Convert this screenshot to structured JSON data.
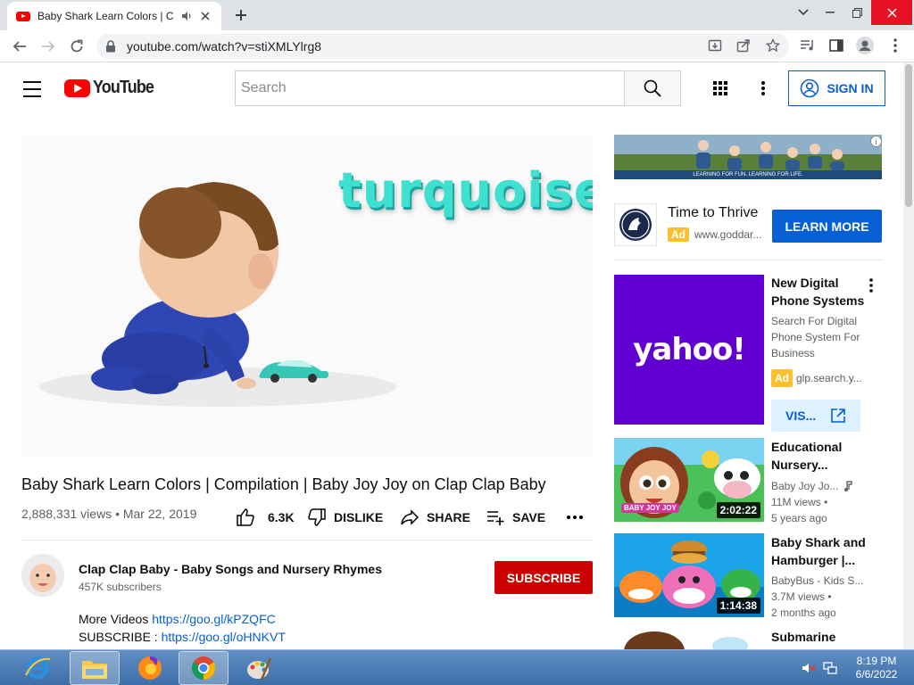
{
  "browser": {
    "tab_title": "Baby Shark Learn Colors | Compilation | Baby Joy Joy on Clap Clap Baby",
    "url": "youtube.com/watch?v=stiXMLYlrg8"
  },
  "header": {
    "logo_text": "YouTube",
    "search_placeholder": "Search",
    "sign_in": "SIGN IN"
  },
  "video": {
    "overlay_word": "turquoise",
    "title": "Baby Shark Learn Colors | Compilation | Baby Joy Joy on Clap Clap Baby",
    "meta": "2,888,331 views • Mar 22, 2019",
    "likes": "6.3K",
    "dislike": "DISLIKE",
    "share": "SHARE",
    "save": "SAVE"
  },
  "channel": {
    "name": "Clap Clap Baby - Baby Songs and Nursery Rhymes",
    "subscribers": "457K subscribers",
    "subscribe": "SUBSCRIBE"
  },
  "description": {
    "line1_label": "More Videos ",
    "line1_link": "https://goo.gl/kPZQFC",
    "line2_label": "SUBSCRIBE : ",
    "line2_link": "https://goo.gl/oHNKVT"
  },
  "sidebar": {
    "banner_caption": "LEARNING FOR FUN. LEARNING FOR LIFE.",
    "sponsor": {
      "title": "Time to Thrive",
      "badge": "Ad",
      "url": "www.goddar...",
      "cta": "LEARN MORE"
    },
    "yahoo_ad": {
      "logo": "yahoo!",
      "title": "New Digital Phone Systems",
      "description": "Search For Digital Phone System For Business",
      "badge": "Ad",
      "domain": "glp.search.y...",
      "cta": "VIS..."
    },
    "videos": [
      {
        "title": "Educational Nursery...",
        "channel": "Baby Joy Jo...",
        "views": "11M views •",
        "age": "5 years ago",
        "duration": "2:02:22",
        "thumb_text": "BABY JOY JOY"
      },
      {
        "title": "Baby Shark and Hamburger |...",
        "channel": "BabyBus - Kids S...",
        "views": "3.7M views •",
        "age": "2 months ago",
        "duration": "1:14:38"
      },
      {
        "title": "Submarine"
      }
    ]
  },
  "taskbar": {
    "time": "8:19 PM",
    "date": "6/6/2022"
  },
  "colors": {
    "youtube_red": "#ff0000",
    "subscribe_red": "#cc0000",
    "link_blue": "#065fd4",
    "yahoo_purple": "#6001d2",
    "turquoise": "#40e0d0"
  }
}
